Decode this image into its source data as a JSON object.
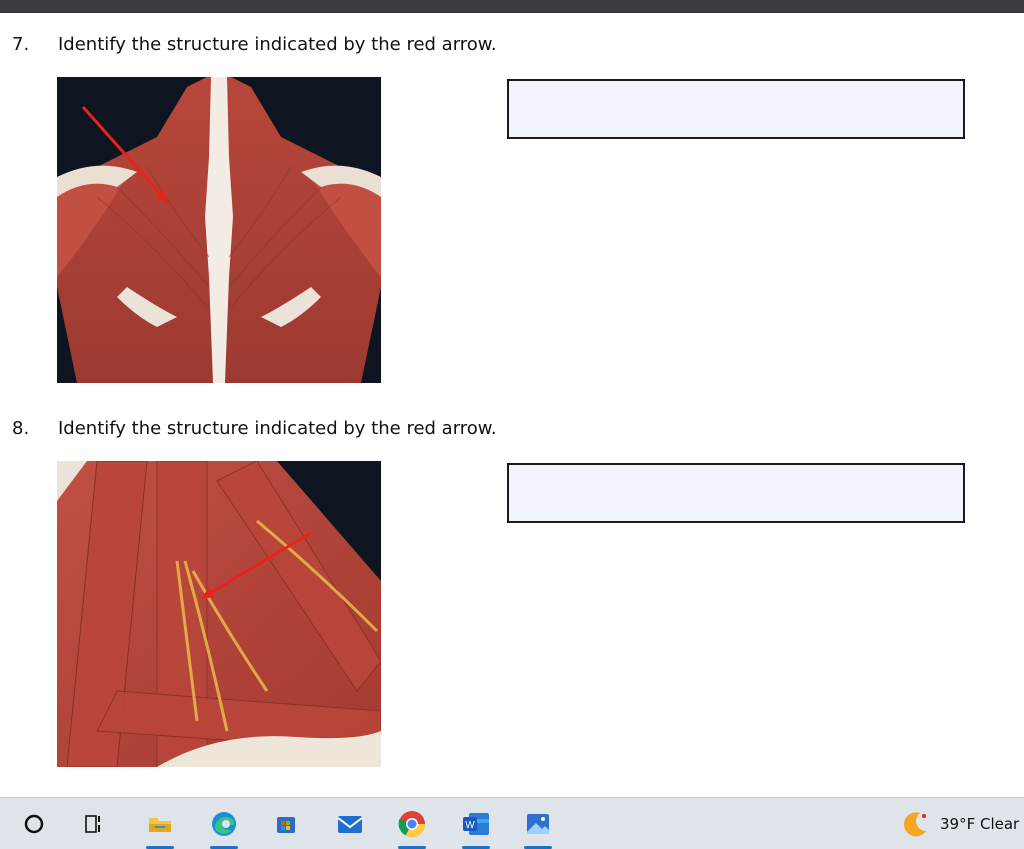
{
  "questions": [
    {
      "number": "7.",
      "prompt": "Identify the structure indicated by the red arrow.",
      "answer_value": "",
      "image": "back-muscles-trapezius"
    },
    {
      "number": "8.",
      "prompt": "Identify the structure indicated by the red arrow.",
      "answer_value": "",
      "image": "neck-muscles-nerves"
    }
  ],
  "taskbar": {
    "apps": [
      {
        "name": "start-search",
        "icon": "search-circle-icon"
      },
      {
        "name": "task-view",
        "icon": "task-view-icon"
      },
      {
        "name": "file-explorer",
        "icon": "folder-icon"
      },
      {
        "name": "edge",
        "icon": "edge-icon"
      },
      {
        "name": "store",
        "icon": "store-icon"
      },
      {
        "name": "mail",
        "icon": "mail-icon"
      },
      {
        "name": "chrome",
        "icon": "chrome-icon"
      },
      {
        "name": "word",
        "icon": "word-icon",
        "label": "W"
      },
      {
        "name": "photos",
        "icon": "photos-icon"
      }
    ],
    "weather": {
      "text": "39°F  Clear",
      "icon": "moon-icon"
    }
  },
  "colors": {
    "answer_box_fill": "#f1f3fd",
    "arrow": "#e8231e",
    "taskbar_bg": "#dfe3ea",
    "active_indicator": "#1a73c9"
  }
}
